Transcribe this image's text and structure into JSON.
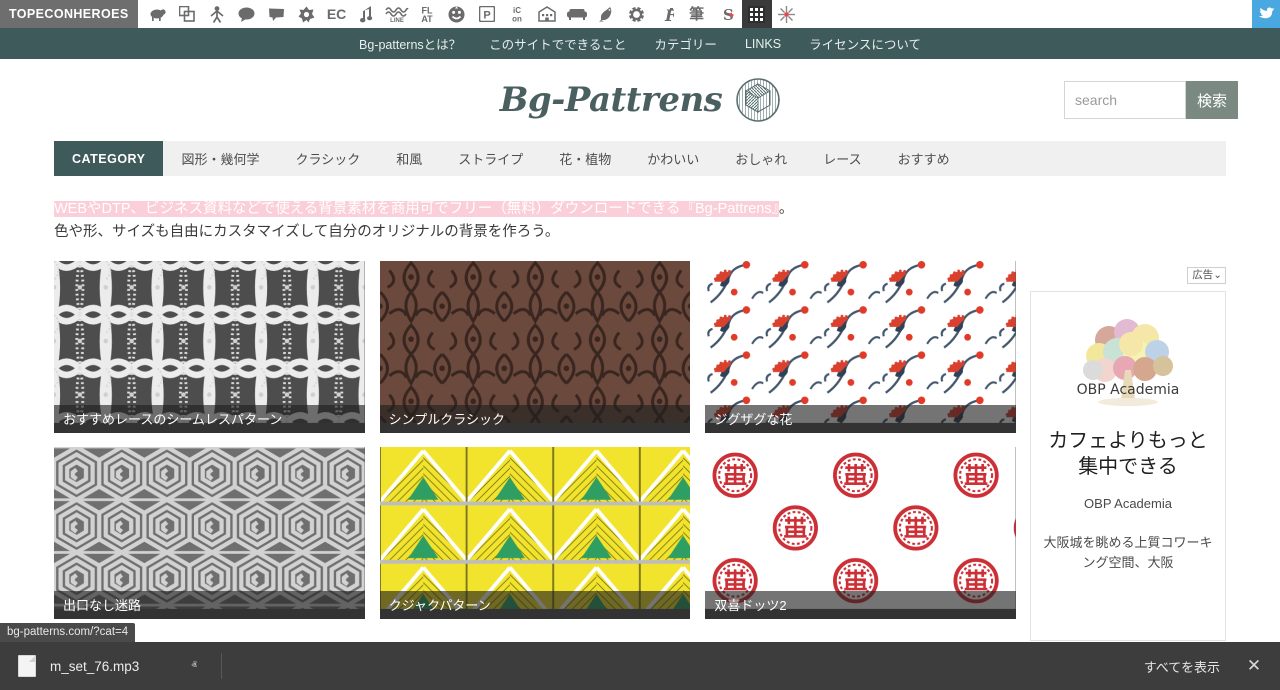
{
  "topecon": {
    "logo": "TOPECONHEROES",
    "icons": [
      {
        "name": "sheep-icon",
        "glyph": " "
      },
      {
        "name": "copy-icon",
        "glyph": " "
      },
      {
        "name": "person-icon",
        "glyph": " "
      },
      {
        "name": "speech-bubble-icon",
        "glyph": " "
      },
      {
        "name": "callout-icon",
        "glyph": " "
      },
      {
        "name": "flower-icon",
        "glyph": " "
      },
      {
        "name": "ec-icon",
        "glyph": "EC"
      },
      {
        "name": "music-note-icon",
        "glyph": "♪"
      },
      {
        "name": "line-icon",
        "glyph": "LINE"
      },
      {
        "name": "flat-icon",
        "glyph": "FLAT"
      },
      {
        "name": "smiley-icon",
        "glyph": " "
      },
      {
        "name": "parking-p-icon",
        "glyph": "P"
      },
      {
        "name": "icon-icon",
        "glyph": "iCon"
      },
      {
        "name": "building-icon",
        "glyph": " "
      },
      {
        "name": "sofa-icon",
        "glyph": " "
      },
      {
        "name": "bird-icon",
        "glyph": " "
      },
      {
        "name": "gear-icon",
        "glyph": " "
      },
      {
        "name": "f-letter-icon",
        "glyph": "F"
      },
      {
        "name": "brush-icon",
        "glyph": "筆"
      },
      {
        "name": "s-letter-icon",
        "glyph": "S"
      },
      {
        "name": "grid-pattern-icon",
        "glyph": " ",
        "selected": true
      },
      {
        "name": "sparkle-icon",
        "glyph": " "
      }
    ],
    "twitter": "twitter-icon"
  },
  "global_nav": {
    "items": [
      "Bg-patternsとは？",
      "このサイトでできること",
      "カテゴリー",
      "LINKS",
      "ライセンスについて"
    ]
  },
  "header": {
    "logo_text": "Bg-Pattrens",
    "logo_mark": "hex-cube-icon"
  },
  "search": {
    "value": "",
    "placeholder": "search",
    "button_label": "検索"
  },
  "category_bar": {
    "label": "CATEGORY",
    "items": [
      "図形・幾何学",
      "クラシック",
      "和風",
      "ストライプ",
      "花・植物",
      "かわいい",
      "おしゃれ",
      "レース",
      "おすすめ"
    ]
  },
  "description": {
    "line1_highlighted": "WEBやDTP、ビジネス資料などで使える背景素材を商用可でフリー（無料）ダウンロードできる『Bg-Pattrens』",
    "line1_tail": "。",
    "line2": "色や形、サイズも自由にカスタマイズして自分のオリジナルの背景を作ろう。",
    "highlight_color": "#fbcfd9"
  },
  "cards": [
    {
      "title": "おすすめレースのシームレスパターン",
      "pattern": "lace",
      "bg": "#4d4d4d",
      "fg": "#ffffff"
    },
    {
      "title": "シンプルクラシック",
      "pattern": "damask",
      "bg": "#6b4a3d",
      "fg": "#3a2620"
    },
    {
      "title": "ジグザグな花",
      "pattern": "floral",
      "bg": "#ffffff",
      "fg": "#d9412e"
    },
    {
      "title": "出口なし迷路",
      "pattern": "maze",
      "bg": "#6f6f6f",
      "fg": "#d2d2d2"
    },
    {
      "title": "クジャクパターン",
      "pattern": "peacock",
      "bg": "#f2e32c",
      "fg": "#2f9e63"
    },
    {
      "title": "双喜ドッツ2",
      "pattern": "dots",
      "bg": "#ffffff",
      "fg": "#cc2f36"
    }
  ],
  "ad": {
    "tag_label": "広告",
    "brand_mark": "OBP Academia",
    "headline": "カフェよりもっと集中できる",
    "sub": "OBP Academia",
    "body": "大阪城を眺める上質コワーキング空間、大阪"
  },
  "status_bar": {
    "url": "bg-patterns.com/?cat=4"
  },
  "download_shelf": {
    "file_name": "m_set_76.mp3",
    "file_icon": "audio-file-icon",
    "caret": "ⱏ",
    "show_all_label": "すべてを表示",
    "close_label": "✕"
  }
}
